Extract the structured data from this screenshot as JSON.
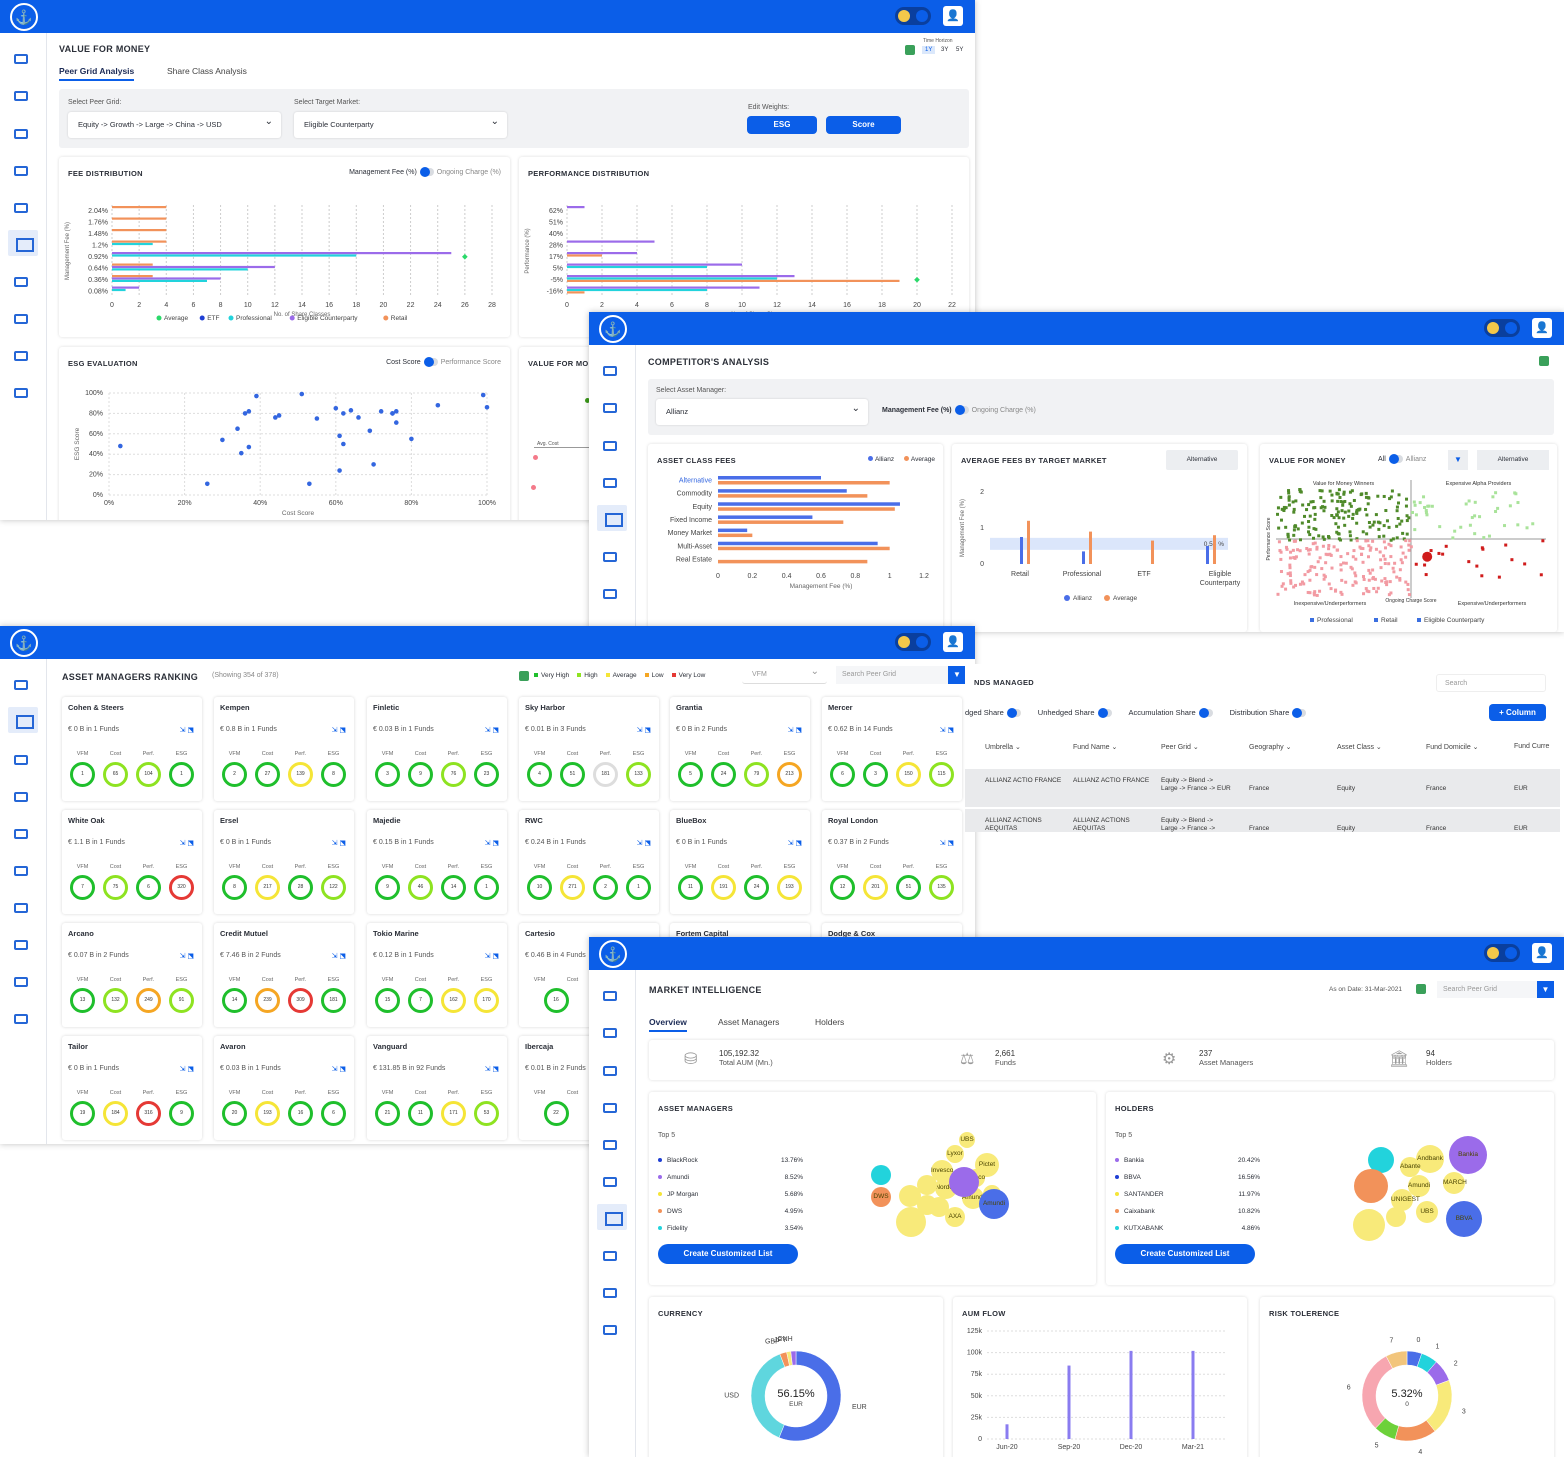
{
  "colors": {
    "primary": "#0b5ee8",
    "average": "#2bd96a",
    "etf": "#1f3fd4",
    "professional": "#22d3dc",
    "eligible": "#9b6bea",
    "retail": "#f2925a"
  },
  "vfm": {
    "title": "VALUE FOR MONEY",
    "time_horizon_label": "Time Horizon",
    "horizons": [
      "1Y",
      "3Y",
      "5Y"
    ],
    "tabs": [
      "Peer Grid Analysis",
      "Share Class Analysis"
    ],
    "peer_grid_label": "Select Peer Grid:",
    "peer_grid_value": "Equity -> Growth -> Large -> China -> USD",
    "target_market_label": "Select Target Market:",
    "target_market_value": "Eligible Counterparty",
    "edit_weights_label": "Edit Weights:",
    "btn_esg": "ESG",
    "btn_score": "Score",
    "fee_title": "FEE DISTRIBUTION",
    "fee_toggle_left": "Management Fee (%)",
    "fee_toggle_right": "Ongoing Charge (%)",
    "perf_title": "PERFORMANCE DISTRIBUTION",
    "esg_title": "ESG EVALUATION",
    "esg_toggle_left": "Cost Score",
    "esg_toggle_right": "Performance Score",
    "vfm_card_title": "VALUE FOR MO",
    "legend": [
      "Average",
      "ETF",
      "Professional",
      "Eligible Counterparty",
      "Retail"
    ]
  },
  "chart_data": [
    {
      "type": "bar",
      "title": "FEE DISTRIBUTION",
      "ylabel": "Management Fee (%)",
      "xlabel": "No. of Share Classes",
      "categories": [
        "2.04%",
        "1.76%",
        "1.48%",
        "1.2%",
        "0.92%",
        "0.64%",
        "0.36%",
        "0.08%"
      ],
      "xticks": [
        "0",
        "2",
        "4",
        "6",
        "8",
        "10",
        "12",
        "14",
        "16",
        "18",
        "20",
        "22",
        "24",
        "26",
        "28"
      ],
      "xlim": [
        0,
        28
      ],
      "series": [
        {
          "name": "Retail",
          "values": [
            4,
            4,
            4,
            4,
            0,
            3,
            3,
            0
          ]
        },
        {
          "name": "Eligible Counterparty",
          "values": [
            0,
            0,
            0,
            0,
            25,
            12,
            8,
            2
          ]
        },
        {
          "name": "Professional",
          "values": [
            0,
            0,
            0,
            3,
            18,
            10,
            7,
            1
          ]
        },
        {
          "name": "Average",
          "values": [
            0,
            0,
            0,
            0,
            26,
            0,
            0,
            0
          ]
        }
      ]
    },
    {
      "type": "bar",
      "title": "PERFORMANCE DISTRIBUTION",
      "ylabel": "Performance (%)",
      "xlabel": "No. of Share Classes",
      "categories": [
        "62%",
        "51%",
        "40%",
        "28%",
        "17%",
        "5%",
        "-5%",
        "-16%"
      ],
      "xticks": [
        "0",
        "2",
        "4",
        "6",
        "8",
        "10",
        "12",
        "14",
        "16",
        "18",
        "20",
        "22"
      ],
      "xlim": [
        0,
        22
      ],
      "series": [
        {
          "name": "Eligible Counterparty",
          "values": [
            1,
            0,
            0,
            5,
            4,
            10,
            13,
            11
          ]
        },
        {
          "name": "Professional",
          "values": [
            0,
            0,
            0,
            0,
            0,
            8,
            12,
            8
          ]
        },
        {
          "name": "Retail",
          "values": [
            0,
            0,
            0,
            0,
            2,
            0,
            19,
            1
          ]
        },
        {
          "name": "Average",
          "values": [
            0,
            0,
            0,
            0,
            0,
            0,
            20,
            0
          ]
        }
      ]
    },
    {
      "type": "scatter",
      "title": "ESG EVALUATION",
      "xlabel": "Cost Score",
      "ylabel": "ESG Score",
      "xticks": [
        "0%",
        "20%",
        "40%",
        "60%",
        "80%",
        "100%"
      ],
      "yticks": [
        "0%",
        "20%",
        "40%",
        "60%",
        "80%",
        "100%"
      ],
      "points": [
        [
          3,
          48
        ],
        [
          26,
          11
        ],
        [
          30,
          54
        ],
        [
          34,
          65
        ],
        [
          35,
          41
        ],
        [
          36,
          80
        ],
        [
          37,
          82
        ],
        [
          37,
          47
        ],
        [
          39,
          97
        ],
        [
          44,
          76
        ],
        [
          45,
          78
        ],
        [
          51,
          99
        ],
        [
          53,
          11
        ],
        [
          55,
          75
        ],
        [
          60,
          85
        ],
        [
          61,
          58
        ],
        [
          61,
          24
        ],
        [
          62,
          50
        ],
        [
          62,
          80
        ],
        [
          64,
          83
        ],
        [
          66,
          76
        ],
        [
          69,
          63
        ],
        [
          70,
          30
        ],
        [
          72,
          82
        ],
        [
          75,
          80
        ],
        [
          75,
          80
        ],
        [
          76,
          71
        ],
        [
          76,
          82
        ],
        [
          80,
          55
        ],
        [
          87,
          88
        ],
        [
          99,
          98
        ],
        [
          100,
          86
        ]
      ]
    },
    {
      "type": "bar",
      "title": "ASSET CLASS FEES",
      "xlabel": "Management Fee (%)",
      "categories": [
        "Alternative",
        "Commodity",
        "Equity",
        "Fixed Income",
        "Money Market",
        "Multi-Asset",
        "Real Estate"
      ],
      "xticks": [
        "0",
        "0.2",
        "0.4",
        "0.6",
        "0.8",
        "1",
        "1.2"
      ],
      "series": [
        {
          "name": "Allianz",
          "values": [
            0.6,
            0.75,
            1.06,
            0.55,
            0.17,
            0.93,
            0
          ]
        },
        {
          "name": "Average",
          "values": [
            1.0,
            0.87,
            1.03,
            0.73,
            0.2,
            1.0,
            0.87
          ]
        }
      ]
    },
    {
      "type": "bar",
      "title": "AVERAGE FEES BY TARGET MARKET",
      "ylabel": "Management Fee (%)",
      "categories": [
        "Retail",
        "Professional",
        "ETF",
        "Eligible Counterparty"
      ],
      "yticks": [
        "0",
        "1",
        "2"
      ],
      "annotation": "0.56 %",
      "series": [
        {
          "name": "Allianz",
          "values": [
            0.75,
            0.35,
            0,
            0.5
          ]
        },
        {
          "name": "Average",
          "values": [
            1.2,
            0.9,
            0.65,
            0.8
          ]
        }
      ]
    },
    {
      "type": "bar",
      "title": "AUM FLOW",
      "categories": [
        "Jun-20",
        "Sep-20",
        "Dec-20",
        "Mar-21"
      ],
      "yticks": [
        "0",
        "25k",
        "50k",
        "75k",
        "100k",
        "125k"
      ],
      "values": [
        17000,
        85000,
        102000,
        102000
      ]
    },
    {
      "type": "pie",
      "title": "CURRENCY",
      "center_value": "56.15%",
      "center_label": "EUR",
      "labels": [
        "EUR",
        "USD",
        "GBP",
        "JPY",
        "CNH"
      ],
      "values": [
        56.15,
        38,
        2.5,
        1.5,
        1.85
      ]
    },
    {
      "type": "pie",
      "title": "RISK TOLERENCE",
      "center_value": "5.32%",
      "center_label": "0",
      "labels": [
        "0",
        "1",
        "2",
        "3",
        "4",
        "5",
        "6",
        "7"
      ],
      "values": [
        5.32,
        6,
        8,
        20,
        15,
        8,
        30,
        7.68
      ]
    }
  ],
  "competitor": {
    "title": "COMPETITOR'S ANALYSIS",
    "asset_manager_label": "Select Asset Manager:",
    "asset_manager_value": "Allianz",
    "toggle_left": "Management Fee (%)",
    "toggle_right": "Ongoing Charge (%)",
    "asset_class_title": "ASSET CLASS FEES",
    "legend_allianz": "Allianz",
    "legend_average": "Average",
    "avg_fees_title": "AVERAGE FEES BY TARGET MARKET",
    "alternative_btn": "Alternative",
    "vfm_title": "VALUE FOR MONEY",
    "vfm_toggle_left": "All",
    "vfm_toggle_right": "Allianz",
    "quad_tl": "Value for Money Winners",
    "quad_tr": "Expensive Alpha Providers",
    "quad_bl": "Inexpensive/Underperformers",
    "quad_br": "Expensive/Underperformers",
    "x_axis": "Ongoing Charge Score",
    "y_axis": "Performance Score",
    "vfm_legend": [
      "Professional",
      "Retail",
      "Eligible Counterparty"
    ],
    "avg_cost_label": "Avg. Cost"
  },
  "ranking": {
    "title": "ASSET MANAGERS RANKING",
    "showing": "(Showing 354 of 378)",
    "legend": [
      "Very High",
      "High",
      "Average",
      "Low",
      "Very Low"
    ],
    "legend_colors": [
      "#1fbf2c",
      "#8ee321",
      "#f5e537",
      "#f5a623",
      "#e53935"
    ],
    "sort_value": "VFM",
    "search_placeholder": "Search Peer Grid",
    "col_labels": [
      "VFM",
      "Cost",
      "Perf.",
      "ESG"
    ],
    "managers": [
      {
        "name": "Cohen & Steers",
        "aum": "€ 0 B in 1 Funds",
        "v": [
          "1",
          "65",
          "104",
          "1"
        ],
        "c": [
          "",
          "lime",
          "lime",
          ""
        ]
      },
      {
        "name": "Kempen",
        "aum": "€ 0.8 B in 1 Funds",
        "v": [
          "2",
          "27",
          "139",
          "8"
        ],
        "c": [
          "",
          "",
          "yellow",
          ""
        ]
      },
      {
        "name": "Finletic",
        "aum": "€ 0.03 B in 1 Funds",
        "v": [
          "3",
          "9",
          "76",
          "23"
        ],
        "c": [
          "",
          "",
          "lime",
          ""
        ]
      },
      {
        "name": "Sky Harbor",
        "aum": "€ 0.01 B in 3 Funds",
        "v": [
          "4",
          "51",
          "181",
          "133"
        ],
        "c": [
          "",
          "",
          "grey",
          "lime"
        ]
      },
      {
        "name": "Grantia",
        "aum": "€ 0 B in 2 Funds",
        "v": [
          "5",
          "24",
          "79",
          "213"
        ],
        "c": [
          "",
          "",
          "lime",
          "orange"
        ]
      },
      {
        "name": "Mercer",
        "aum": "€ 0.62 B in 14 Funds",
        "v": [
          "6",
          "3",
          "150",
          "115"
        ],
        "c": [
          "",
          "",
          "yellow",
          "lime"
        ]
      },
      {
        "name": "White Oak",
        "aum": "€ 1.1 B in 1 Funds",
        "v": [
          "7",
          "75",
          "6",
          "320"
        ],
        "c": [
          "",
          "lime",
          "",
          "red"
        ]
      },
      {
        "name": "Ersel",
        "aum": "€ 0 B in 1 Funds",
        "v": [
          "8",
          "217",
          "28",
          "122"
        ],
        "c": [
          "",
          "yellow",
          "",
          "lime"
        ]
      },
      {
        "name": "Majedie",
        "aum": "€ 0.15 B in 1 Funds",
        "v": [
          "9",
          "46",
          "14",
          "1"
        ],
        "c": [
          "",
          "lime",
          "",
          ""
        ]
      },
      {
        "name": "RWC",
        "aum": "€ 0.24 B in 1 Funds",
        "v": [
          "10",
          "271",
          "2",
          "1"
        ],
        "c": [
          "",
          "yellow",
          "",
          ""
        ]
      },
      {
        "name": "BlueBox",
        "aum": "€ 0 B in 1 Funds",
        "v": [
          "11",
          "191",
          "24",
          "193"
        ],
        "c": [
          "",
          "yellow",
          "",
          "yellow"
        ]
      },
      {
        "name": "Royal London",
        "aum": "€ 0.37 B in 2 Funds",
        "v": [
          "12",
          "201",
          "51",
          "135"
        ],
        "c": [
          "",
          "yellow",
          "",
          "lime"
        ]
      },
      {
        "name": "Arcano",
        "aum": "€ 0.07 B in 2 Funds",
        "v": [
          "13",
          "132",
          "249",
          "91"
        ],
        "c": [
          "",
          "lime",
          "orange",
          "lime"
        ]
      },
      {
        "name": "Credit Mutuel",
        "aum": "€ 7.46 B in 2 Funds",
        "v": [
          "14",
          "239",
          "309",
          "181"
        ],
        "c": [
          "",
          "orange",
          "red",
          ""
        ]
      },
      {
        "name": "Tokio Marine",
        "aum": "€ 0.12 B in 1 Funds",
        "v": [
          "15",
          "7",
          "162",
          "170"
        ],
        "c": [
          "",
          "",
          "yellow",
          "yellow"
        ]
      },
      {
        "name": "Cartesio",
        "aum": "€ 0.46 B in 4 Funds",
        "v": [
          "16",
          "52",
          "",
          ""
        ],
        "c": [
          "",
          "lime",
          "",
          ""
        ]
      },
      {
        "name": "Tailor",
        "aum": "€ 0 B in 1 Funds",
        "v": [
          "19",
          "184",
          "316",
          "9"
        ],
        "c": [
          "",
          "yellow",
          "red",
          ""
        ]
      },
      {
        "name": "Avaron",
        "aum": "€ 0.03 B in 1 Funds",
        "v": [
          "20",
          "193",
          "16",
          "6"
        ],
        "c": [
          "",
          "yellow",
          "",
          ""
        ]
      },
      {
        "name": "Vanguard",
        "aum": "€ 131.85 B in 92 Funds",
        "v": [
          "21",
          "11",
          "171",
          "53"
        ],
        "c": [
          "",
          "",
          "yellow",
          "lime"
        ]
      },
      {
        "name": "Ibercaja",
        "aum": "€ 0.01 B in 2 Funds",
        "v": [
          "22",
          "36",
          "",
          ""
        ],
        "c": [
          "",
          "lime",
          "",
          ""
        ]
      }
    ],
    "hidden_names": [
      "Fortem Capital",
      "Dodge & Cox"
    ]
  },
  "funds": {
    "title": "NDS MANAGED",
    "search_placeholder": "Search",
    "toggles": [
      "dged Share",
      "Unhedged Share",
      "Accumulation Share",
      "Distribution Share"
    ],
    "add_column": "+ Column",
    "columns": [
      "Umbrella",
      "Fund Name",
      "Peer Grid",
      "Geography",
      "Asset Class",
      "Fund Domicile",
      "Fund Curre"
    ],
    "rows": [
      [
        "ALLIANZ ACTIO FRANCE",
        "ALLIANZ ACTIO FRANCE",
        "Equity -> Blend -> Large -> France -> EUR",
        "France",
        "Equity",
        "France",
        "EUR"
      ],
      [
        "ALLIANZ ACTIONS AEQUITAS",
        "ALLIANZ ACTIONS AEQUITAS",
        "Equity -> Blend -> Large -> France ->",
        "France",
        "Equity",
        "France",
        "EUR"
      ]
    ]
  },
  "market": {
    "title": "MARKET INTELLIGENCE",
    "as_on": "As on Date: 31-Mar-2021",
    "search_placeholder": "Search Peer Grid",
    "tabs": [
      "Overview",
      "Asset Managers",
      "Holders"
    ],
    "stats": [
      {
        "value": "105,192.32",
        "label": "Total AUM (Mn.)"
      },
      {
        "value": "2,661",
        "label": "Funds"
      },
      {
        "value": "237",
        "label": "Asset Managers"
      },
      {
        "value": "94",
        "label": "Holders"
      }
    ],
    "am_title": "ASSET MANAGERS",
    "holders_title": "HOLDERS",
    "top5": "Top 5",
    "am_list": [
      [
        "BlackRock",
        "13.76%",
        "#1f3fd4"
      ],
      [
        "Amundi",
        "8.52%",
        "#9b6bea"
      ],
      [
        "JP Morgan",
        "5.68%",
        "#f5e537"
      ],
      [
        "DWS",
        "4.95%",
        "#f2925a"
      ],
      [
        "Fidelity",
        "3.54%",
        "#22d3dc"
      ]
    ],
    "holders_list": [
      [
        "Bankia",
        "20.42%",
        "#9b6bea"
      ],
      [
        "BBVA",
        "16.56%",
        "#1f3fd4"
      ],
      [
        "SANTANDER",
        "11.97%",
        "#f5e537"
      ],
      [
        "Caixabank",
        "10.82%",
        "#f2925a"
      ],
      [
        "KUTXABANK",
        "4.86%",
        "#22d3dc"
      ]
    ],
    "create_list": "Create Customized List",
    "am_bubbles": [
      "UBS",
      "Lyxor",
      "Pictet",
      "Invesco",
      "Pimco",
      "DWS",
      "Nordea",
      "Amundi",
      "AXA"
    ],
    "holder_bubbles": [
      "Andbank",
      "Bankia",
      "Abante",
      "Amundi",
      "MARCH",
      "UNIGEST",
      "UBS",
      "BBVA"
    ],
    "currency_title": "CURRENCY",
    "aum_title": "AUM FLOW",
    "risk_title": "RISK TOLERENCE"
  }
}
